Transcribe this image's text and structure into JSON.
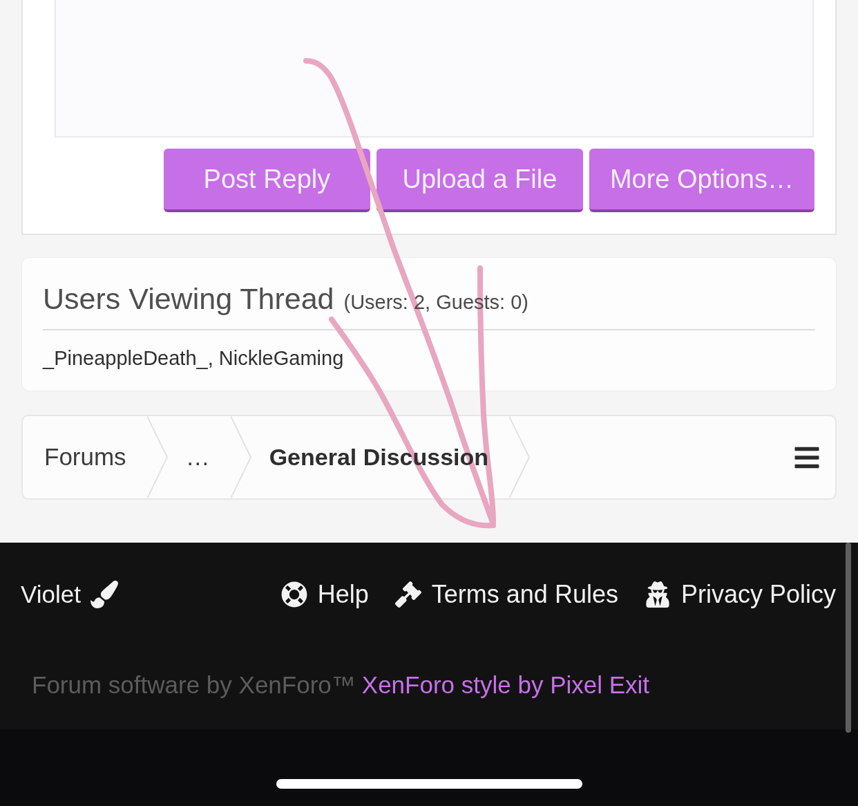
{
  "reply_editor": {
    "buttons": [
      {
        "label": "Post Reply"
      },
      {
        "label": "Upload a File"
      },
      {
        "label": "More Options…"
      }
    ]
  },
  "users_viewing": {
    "title": "Users Viewing Thread",
    "counts": "(Users: 2, Guests: 0)",
    "users": "_PineappleDeath_, NickleGaming"
  },
  "breadcrumb": {
    "items": [
      {
        "label": "Forums",
        "selected": false
      },
      {
        "label": "…",
        "selected": false
      },
      {
        "label": "General Discussion",
        "selected": true
      }
    ]
  },
  "footer": {
    "style_chooser": {
      "label": "Violet"
    },
    "links": [
      {
        "kind": "help",
        "label": "Help"
      },
      {
        "kind": "terms",
        "label": "Terms and Rules"
      },
      {
        "kind": "privacy",
        "label": "Privacy Policy"
      }
    ],
    "copyright": {
      "software": "Forum software by XenForo™",
      "style_credit": "XenForo style by Pixel Exit"
    }
  }
}
